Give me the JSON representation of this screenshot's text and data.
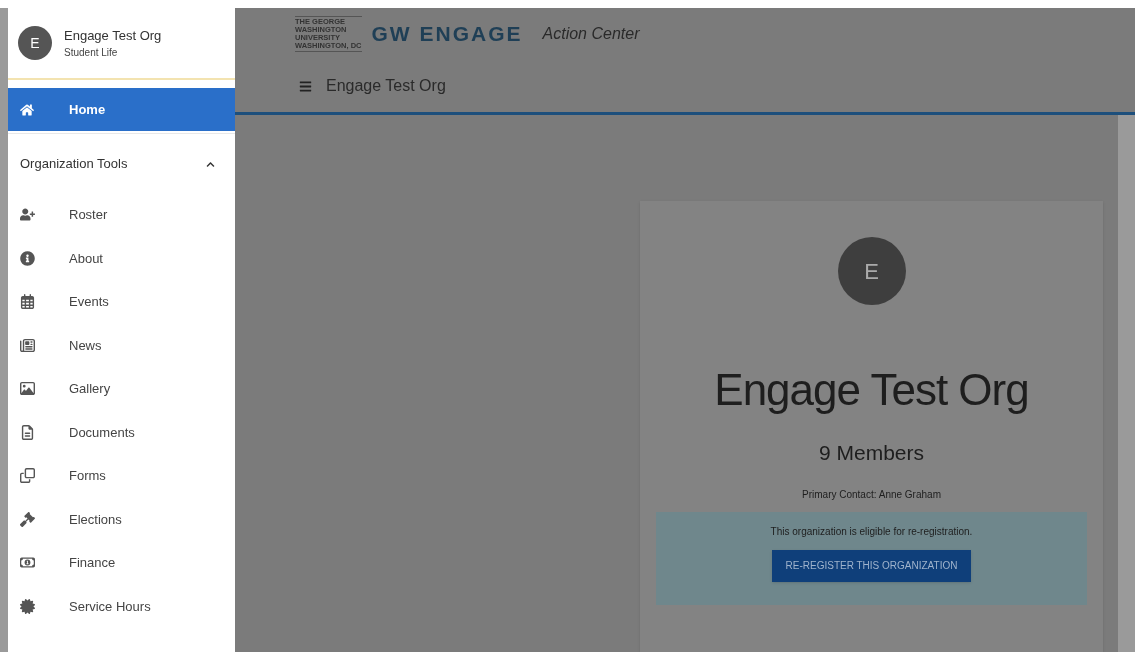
{
  "sidebar": {
    "org": {
      "initial": "E",
      "name": "Engage Test Org",
      "category": "Student Life"
    },
    "home": {
      "label": "Home",
      "selected": true
    },
    "section": {
      "label": "Organization Tools",
      "expanded": true,
      "items": [
        {
          "label": "Roster",
          "selected": false
        },
        {
          "label": "About",
          "selected": false
        },
        {
          "label": "Events",
          "selected": false
        },
        {
          "label": "News",
          "selected": false
        },
        {
          "label": "Gallery",
          "selected": false
        },
        {
          "label": "Documents",
          "selected": false
        },
        {
          "label": "Forms",
          "selected": false
        },
        {
          "label": "Elections",
          "selected": false
        },
        {
          "label": "Finance",
          "selected": false
        },
        {
          "label": "Service Hours",
          "selected": false
        }
      ]
    }
  },
  "header": {
    "logo_lines": [
      "THE GEORGE",
      "WASHINGTON",
      "UNIVERSITY",
      "WASHINGTON, DC"
    ],
    "brand": "GW ENGAGE",
    "subtitle": "Action Center",
    "org_title": "Engage Test Org"
  },
  "card": {
    "initial": "E",
    "name": "Engage Test Org",
    "members": "9 Members",
    "contact": "Primary Contact: Anne Graham",
    "notice": "This organization is eligible for re-registration.",
    "button": "RE-REGISTER THIS ORGANIZATION"
  }
}
